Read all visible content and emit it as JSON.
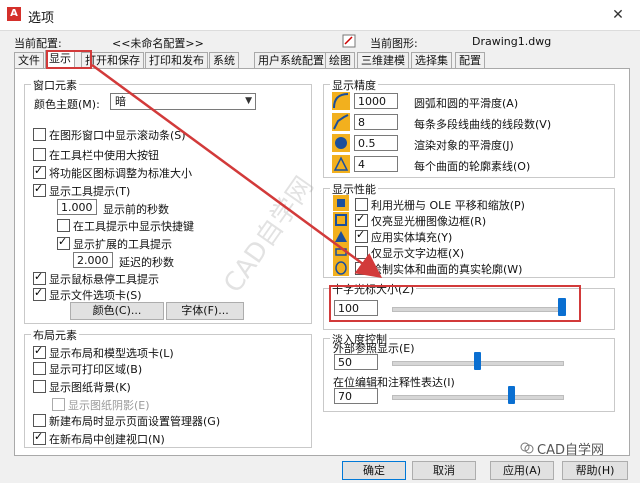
{
  "window": {
    "title": "选项",
    "app_icon_letter": "A"
  },
  "header": {
    "current_profile_label": "当前配置:",
    "current_profile_value": "<<未命名配置>>",
    "current_drawing_label": "当前图形:",
    "current_drawing_value": "Drawing1.dwg"
  },
  "tabs": [
    "文件",
    "显示",
    "打开和保存",
    "打印和发布",
    "系统",
    "用户系统配置",
    "绘图",
    "三维建模",
    "选择集",
    "配置"
  ],
  "window_elements": {
    "title": "窗口元素",
    "color_theme_label": "颜色主题(M):",
    "color_theme_value": "暗",
    "show_scrollbars": "在图形窗口中显示滚动条(S)",
    "large_buttons": "在工具栏中使用大按钮",
    "resize_ribbon_icons": "将功能区图标调整为标准大小",
    "show_tooltips": "显示工具提示(T)",
    "delay_before": "1.000",
    "delay_before_label": "显示前的秒数",
    "show_shortcut_keys": "在工具提示中显示快捷键",
    "show_extended_tooltips": "显示扩展的工具提示",
    "extended_delay": "2.000",
    "extended_delay_label": "延迟的秒数",
    "show_rollover": "显示鼠标悬停工具提示",
    "show_file_tabs": "显示文件选项卡(S)",
    "colors_button": "颜色(C)...",
    "fonts_button": "字体(F)..."
  },
  "layout_elements": {
    "title": "布局元素",
    "show_layout_tabs": "显示布局和模型选项卡(L)",
    "show_printable_area": "显示可打印区域(B)",
    "show_paper_background": "显示图纸背景(K)",
    "show_paper_shadow": "显示图纸阴影(E)",
    "show_page_setup_manager": "新建布局时显示页面设置管理器(G)",
    "create_viewport": "在新布局中创建视口(N)"
  },
  "display_resolution": {
    "title": "显示精度",
    "arc_smoothness": "1000",
    "arc_smoothness_label": "圆弧和圆的平滑度(A)",
    "polyline_segments": "8",
    "polyline_segments_label": "每条多段线曲线的线段数(V)",
    "rendered_smoothness": "0.5",
    "rendered_smoothness_label": "渲染对象的平滑度(J)",
    "contour_lines": "4",
    "contour_lines_label": "每个曲面的轮廓素线(O)"
  },
  "display_performance": {
    "title": "显示性能",
    "raster_pan_zoom": "利用光栅与 OLE 平移和缩放(P)",
    "highlight_raster_frame": "仅亮显光栅图像边框(R)",
    "apply_solid_fill": "应用实体填充(Y)",
    "text_boundary_frame": "仅显示文字边框(X)",
    "true_silhouettes": "绘制实体和曲面的真实轮廓(W)"
  },
  "crosshair": {
    "title": "十字光标大小(Z)",
    "value": "100",
    "slider_fraction": 1.0
  },
  "fade": {
    "title": "淡入度控制",
    "xref_label": "外部参照显示(E)",
    "xref_value": "50",
    "xref_fraction": 0.5,
    "inplace_label": "在位编辑和注释性表达(I)",
    "inplace_value": "70",
    "inplace_fraction": 0.7
  },
  "footer": {
    "ok": "确定",
    "cancel": "取消",
    "apply": "应用(A)",
    "help": "帮助(H)"
  },
  "overlay": {
    "watermark": "CAD自学网",
    "brand_text": "CAD自学网"
  },
  "colors": {
    "annotation_red": "#d23a3a",
    "accent_blue": "#0a6fd1",
    "icon_yellow": "#f2b01e"
  }
}
